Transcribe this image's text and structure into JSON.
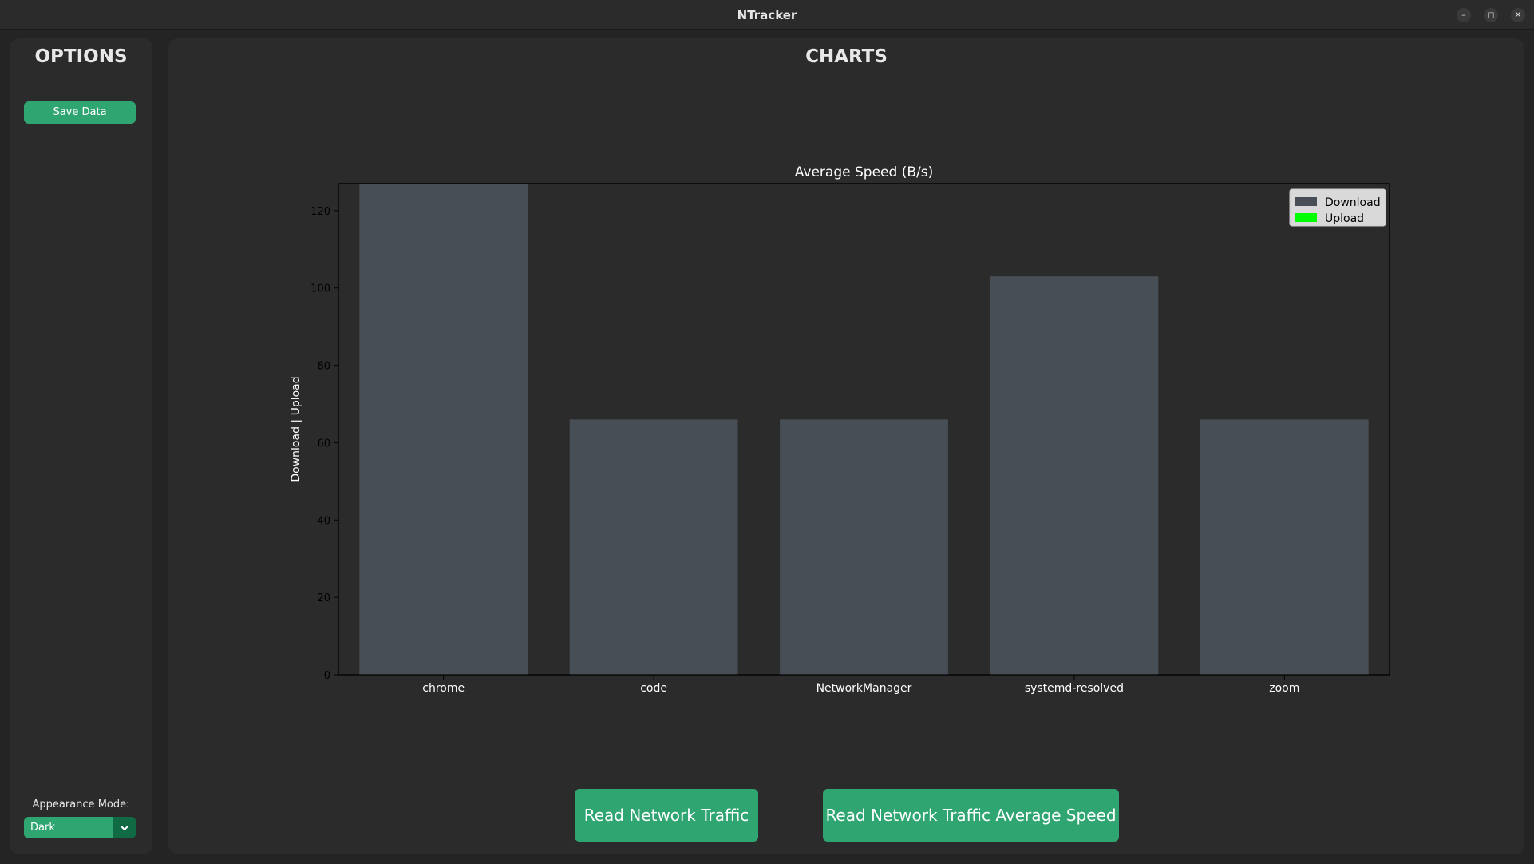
{
  "window": {
    "title": "NTracker",
    "controls": {
      "minimize": "–",
      "maximize": "◻",
      "close": "✕"
    }
  },
  "sidebar": {
    "heading": "OPTIONS",
    "save_button": "Save Data",
    "appearance_label": "Appearance Mode:",
    "appearance_value": "Dark"
  },
  "main": {
    "heading": "CHARTS",
    "buttons": {
      "read_traffic": "Read Network Traffic",
      "read_avg_speed": "Read Network Traffic Average Speed"
    }
  },
  "colors": {
    "accent": "#2fa572",
    "accent_dark": "#106a43",
    "download": "#474e56",
    "upload": "#00ff00"
  },
  "icons": {
    "dropdown": "chevron-down-icon",
    "minimize": "minimize-icon",
    "maximize": "maximize-icon",
    "close": "close-icon"
  },
  "chart_data": {
    "type": "bar",
    "title": "Average Speed (B/s)",
    "xlabel": "",
    "ylabel": "Download | Upload",
    "categories": [
      "chrome",
      "code",
      "NetworkManager",
      "systemd-resolved",
      "zoom"
    ],
    "series": [
      {
        "name": "Download",
        "values": [
          127,
          66,
          66,
          103,
          66
        ]
      },
      {
        "name": "Upload",
        "values": [
          0,
          0,
          0,
          0,
          0
        ]
      }
    ],
    "ylim": [
      0,
      127
    ],
    "yticks": [
      0,
      20,
      40,
      60,
      80,
      100,
      120
    ],
    "legend": {
      "placement": "top-right",
      "entries": [
        "Download",
        "Upload"
      ]
    },
    "grid": false
  }
}
